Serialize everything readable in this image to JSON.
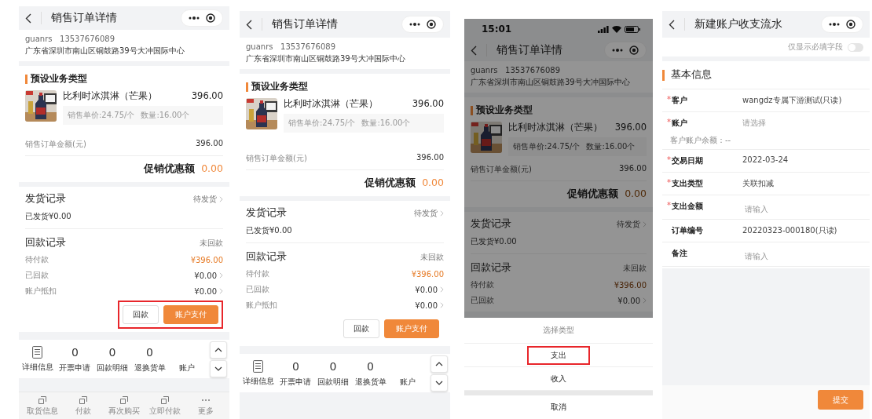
{
  "screens": [
    {
      "kind": "order",
      "highlight_actions": true,
      "nav": {
        "title": "销售订单详情"
      },
      "customer": {
        "name": "guanrs",
        "phone": "13537676089",
        "address": "广东省深圳市南山区铜鼓路39号大冲国际中心"
      },
      "product_section": {
        "title": "预设业务类型",
        "product": {
          "name": "比利时冰淇淋（芒果）",
          "price": "396.00",
          "unit_price": "销售单价:24.75/个",
          "quantity": "数量:16.00个"
        },
        "amount_label": "销售订单金额(元)",
        "amount": "396.00",
        "promo_label": "促销优惠额",
        "promo_value": "0.00"
      },
      "shipping": {
        "title": "发货记录",
        "status": "待发货",
        "summary": "已发货¥0.00"
      },
      "payment": {
        "title": "回款记录",
        "status": "未回款",
        "rows": [
          {
            "label": "待付款",
            "value": "¥396.00",
            "emphasis": true,
            "link": false
          },
          {
            "label": "已回款",
            "value": "¥0.00",
            "emphasis": false,
            "link": true
          },
          {
            "label": "账户抵扣",
            "value": "¥0.00",
            "emphasis": false,
            "link": true
          }
        ]
      },
      "actions": [
        {
          "label": "回款",
          "kind": "secondary"
        },
        {
          "label": "账户支付",
          "kind": "primary"
        }
      ],
      "toolbar": [
        {
          "kind": "icon",
          "label": "详细信息"
        },
        {
          "kind": "count",
          "value": "0",
          "label": "开票申请"
        },
        {
          "kind": "count",
          "value": "0",
          "label": "回款明细"
        },
        {
          "kind": "count",
          "value": "0",
          "label": "退换货单"
        },
        {
          "kind": "icon_hidden",
          "label": "账户"
        }
      ],
      "bottom_bar": [
        {
          "kind": "square",
          "label": "取货信息"
        },
        {
          "kind": "square",
          "label": "付款"
        },
        {
          "kind": "square",
          "label": "再次购买"
        },
        {
          "kind": "square",
          "label": "立即付款"
        },
        {
          "kind": "more",
          "label": "更多"
        }
      ]
    },
    {
      "kind": "order",
      "highlight_actions": false,
      "nav": {
        "title": "销售订单详情"
      },
      "customer": {
        "name": "guanrs",
        "phone": "13537676089",
        "address": "广东省深圳市南山区铜鼓路39号大冲国际中心"
      },
      "product_section": {
        "title": "预设业务类型",
        "product": {
          "name": "比利时冰淇淋（芒果）",
          "price": "396.00",
          "unit_price": "销售单价:24.75/个",
          "quantity": "数量:16.00个"
        },
        "amount_label": "销售订单金额(元)",
        "amount": "396.00",
        "promo_label": "促销优惠额",
        "promo_value": "0.00"
      },
      "shipping": {
        "title": "发货记录",
        "status": "待发货",
        "summary": "已发货¥0.00"
      },
      "payment": {
        "title": "回款记录",
        "status": "未回款",
        "rows": [
          {
            "label": "待付款",
            "value": "¥396.00",
            "emphasis": true,
            "link": false
          },
          {
            "label": "已回款",
            "value": "¥0.00",
            "emphasis": false,
            "link": true
          },
          {
            "label": "账户抵扣",
            "value": "¥0.00",
            "emphasis": false,
            "link": true
          }
        ]
      },
      "actions": [
        {
          "label": "回款",
          "kind": "secondary"
        },
        {
          "label": "账户支付",
          "kind": "primary"
        }
      ],
      "toolbar": [
        {
          "kind": "icon",
          "label": "详细信息"
        },
        {
          "kind": "count",
          "value": "0",
          "label": "开票申请"
        },
        {
          "kind": "count",
          "value": "0",
          "label": "回款明细"
        },
        {
          "kind": "count",
          "value": "0",
          "label": "退换货单"
        },
        {
          "kind": "icon_hidden",
          "label": "账户"
        }
      ]
    },
    {
      "kind": "order",
      "status_bar": {
        "time": "15:01"
      },
      "nav": {
        "title": "销售订单详情"
      },
      "customer": {
        "name": "guanrs",
        "phone": "13537676089",
        "address": "广东省深圳市南山区铜鼓路39号大冲国际中心"
      },
      "product_section": {
        "title": "预设业务类型",
        "product": {
          "name": "比利时冰淇淋（芒果）",
          "price": "396.00",
          "unit_price": "销售单价:24.75/个",
          "quantity": "数量:16.00个"
        },
        "amount_label": "销售订单金额(元)",
        "amount": "396.00",
        "promo_label": "促销优惠额",
        "promo_value": "0.00"
      },
      "shipping": {
        "title": "发货记录",
        "status": "待发货",
        "summary": "已发货¥0.00"
      },
      "payment": {
        "title": "回款记录",
        "status": "未回款",
        "rows": [
          {
            "label": "待付款",
            "value": "¥396.00",
            "emphasis": true,
            "link": false
          },
          {
            "label": "已回款",
            "value": "¥0.00",
            "emphasis": false,
            "link": true
          }
        ]
      },
      "action_sheet": {
        "title": "选择类型",
        "options": [
          {
            "label": "支出",
            "highlighted": true
          },
          {
            "label": "收入",
            "highlighted": false
          }
        ],
        "cancel": "取消"
      }
    },
    {
      "kind": "form",
      "nav": {
        "title": "新建账户收支流水"
      },
      "toggle": {
        "label": "仅显示必填字段",
        "on": false
      },
      "section_title": "基本信息",
      "fields": [
        {
          "kind": "value",
          "required_mark": "*",
          "label": "客户",
          "value": "wangdz专属下游测试(只读)"
        },
        {
          "kind": "select",
          "required_mark": "*",
          "label": "账户",
          "placeholder": "请选择",
          "note": "客户账户余额：--"
        },
        {
          "kind": "value",
          "required_mark": "*",
          "label": "交易日期",
          "value": "2022-03-24"
        },
        {
          "kind": "value",
          "required_mark": "*",
          "label": "支出类型",
          "value": "关联扣减"
        },
        {
          "kind": "input",
          "required_mark": "*",
          "label": "支出金额",
          "placeholder": "请输入"
        },
        {
          "kind": "value",
          "label": "订单编号",
          "value": "20220323-000180(只读)"
        },
        {
          "kind": "input",
          "label": "备注",
          "placeholder": "请输入"
        }
      ],
      "submit": "提交"
    }
  ]
}
